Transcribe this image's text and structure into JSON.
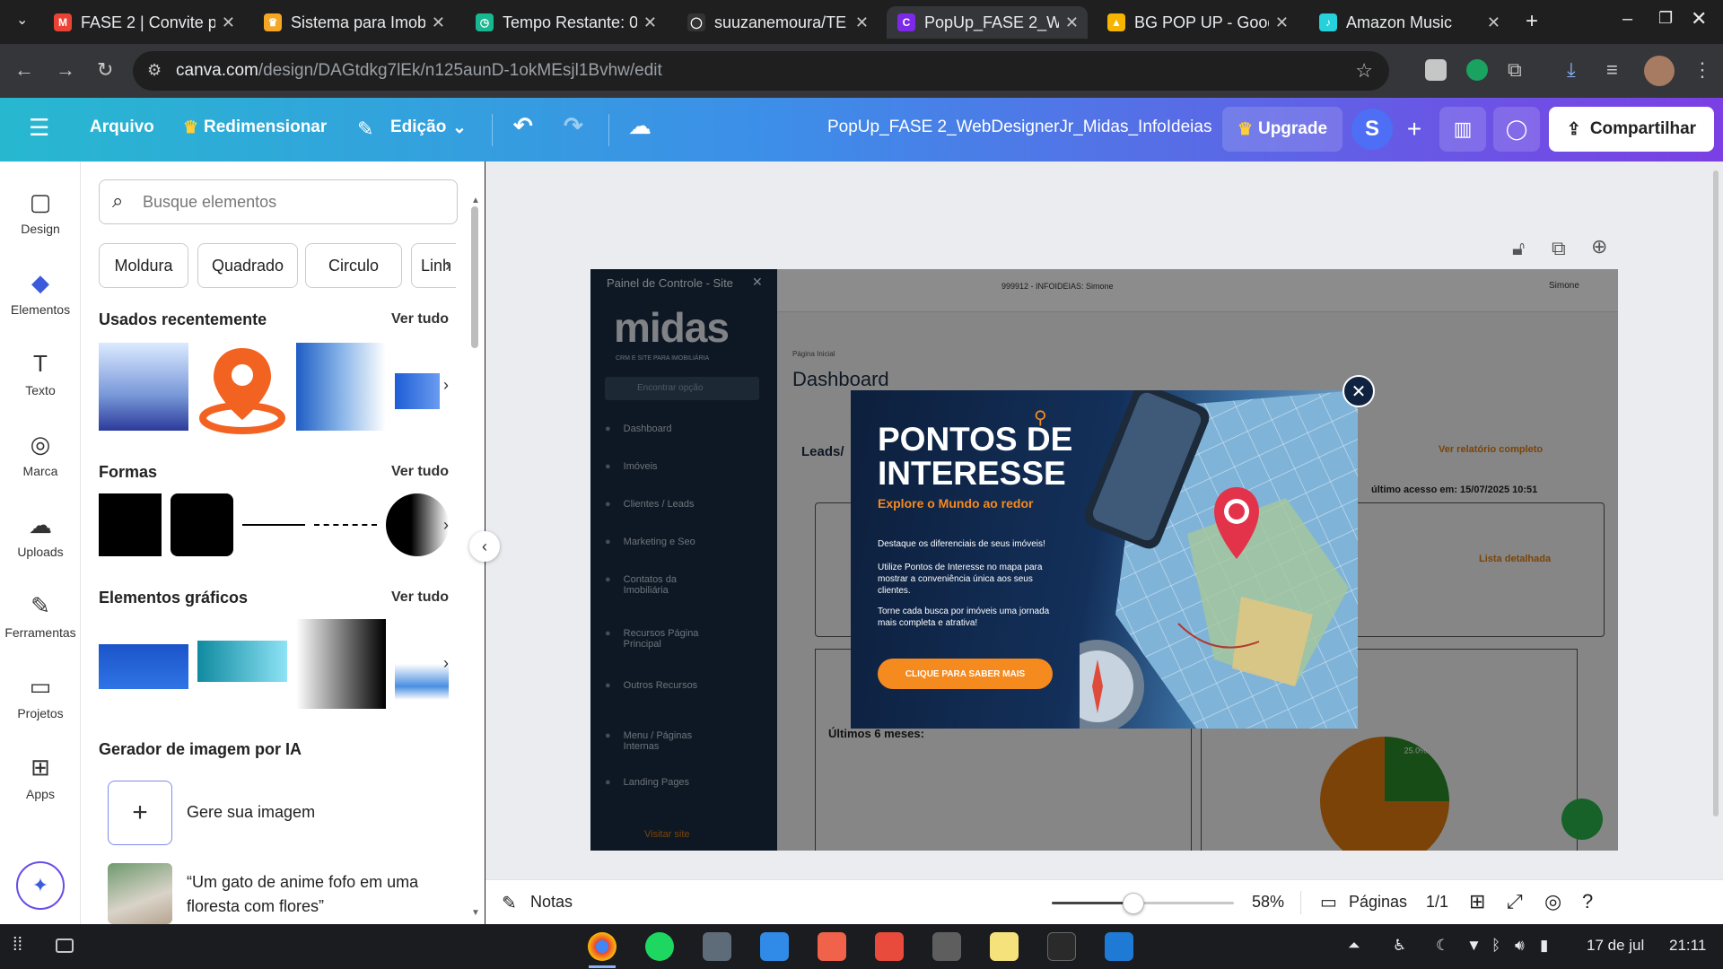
{
  "browser": {
    "tabs": [
      {
        "title": "FASE 2 | Convite pa",
        "fav_color": "#ea4335",
        "fav_text": "M"
      },
      {
        "title": "Sistema para Imobi",
        "fav_color": "#f5a623",
        "fav_text": "♛"
      },
      {
        "title": "Tempo Restante: 0",
        "fav_color": "#17b890",
        "fav_text": "◷"
      },
      {
        "title": "suuzanemoura/TE",
        "fav_color": "#333333",
        "fav_text": "◯"
      },
      {
        "title": "PopUp_FASE 2_We",
        "fav_color": "#7d2ae8",
        "fav_text": "C"
      },
      {
        "title": "BG POP UP - Goog",
        "fav_color": "#f4b400",
        "fav_text": "▲"
      },
      {
        "title": "Amazon Music",
        "fav_color": "#25d1da",
        "fav_text": "♪"
      }
    ],
    "url_host": "canva.com",
    "url_path": "/design/DAGtdkg7lEk/n125aunD-1okMEsjl1Bvhw/edit"
  },
  "header": {
    "file": "Arquivo",
    "resize": "Redimensionar",
    "edit": "Edição",
    "doc_title": "PopUp_FASE 2_WebDesignerJr_Midas_InfoIdeias",
    "upgrade": "Upgrade",
    "avatar_letter": "S",
    "share": "Compartilhar"
  },
  "rail": {
    "items": [
      {
        "label": "Design",
        "icon": "▢"
      },
      {
        "label": "Elementos",
        "icon": "◆"
      },
      {
        "label": "Texto",
        "icon": "T"
      },
      {
        "label": "Marca",
        "icon": "◎"
      },
      {
        "label": "Uploads",
        "icon": "☁"
      },
      {
        "label": "Ferramentas",
        "icon": "✎"
      },
      {
        "label": "Projetos",
        "icon": "▭"
      },
      {
        "label": "Apps",
        "icon": "⊞"
      }
    ]
  },
  "panel": {
    "search_placeholder": "Busque elementos",
    "chips": [
      "Moldura",
      "Quadrado",
      "Circulo",
      "Linh"
    ],
    "recent": "Usados recentemente",
    "shapes": "Formas",
    "graphics": "Elementos gráficos",
    "see_all": "Ver tudo",
    "ai_title": "Gerador de imagem por IA",
    "ai_generate": "Gere sua imagem",
    "ai_prompt": "“Um gato de anime fofo em uma floresta com flores”"
  },
  "design": {
    "sidebar_title": "Painel de Controle - Site",
    "logo": "midas",
    "logo_sub": "CRM E SITE PARA IMOBILIÁRIA",
    "search": "Encontrar opção",
    "nav": [
      "Dashboard",
      "Imóveis",
      "Clientes / Leads",
      "Marketing e Seo",
      "Contatos da Imobiliária",
      "Recursos Página Principal",
      "Outros Recursos",
      "Menu / Páginas Internas",
      "Landing Pages"
    ],
    "visit": "Visitar site",
    "account": "999912 - INFOIDEIAS: Simone",
    "user": "Simone",
    "breadcrumb": "Página Inicial",
    "page_title": "Dashboard",
    "leads": "Leads/",
    "report": "Ver relatório completo",
    "last_access": "último acesso em: 15/07/2025 10:51",
    "detail_list": "Lista detalhada",
    "last6": "Últimos 6 meses:",
    "pie": [
      {
        "label": "25.0%",
        "value": 25,
        "color": "#2a8a2a"
      },
      {
        "label": "75.0%",
        "value": 75,
        "color": "#e07b10"
      }
    ]
  },
  "popup": {
    "title1": "PONTOS DE",
    "title2": "INTERESSE",
    "subtitle": "Explore o Mundo ao redor",
    "p1": "Destaque os diferenciais de seus imóveis!",
    "p2": "Utilize Pontos de Interesse no mapa para mostrar a conveniência única aos seus clientes.",
    "p3": "Torne cada busca por imóveis uma jornada mais completa e atrativa!",
    "cta": "CLIQUE PARA SABER MAIS"
  },
  "bottom": {
    "notes": "Notas",
    "zoom": "58%",
    "zoom_fraction": 0.45,
    "pages": "Páginas",
    "page_count": "1/1"
  },
  "taskbar": {
    "date": "17 de jul",
    "time": "21:11"
  },
  "colors": {
    "accent_orange": "#f58a1f",
    "canva_purple": "#7d2ae8",
    "navy": "#0d1f3c"
  }
}
